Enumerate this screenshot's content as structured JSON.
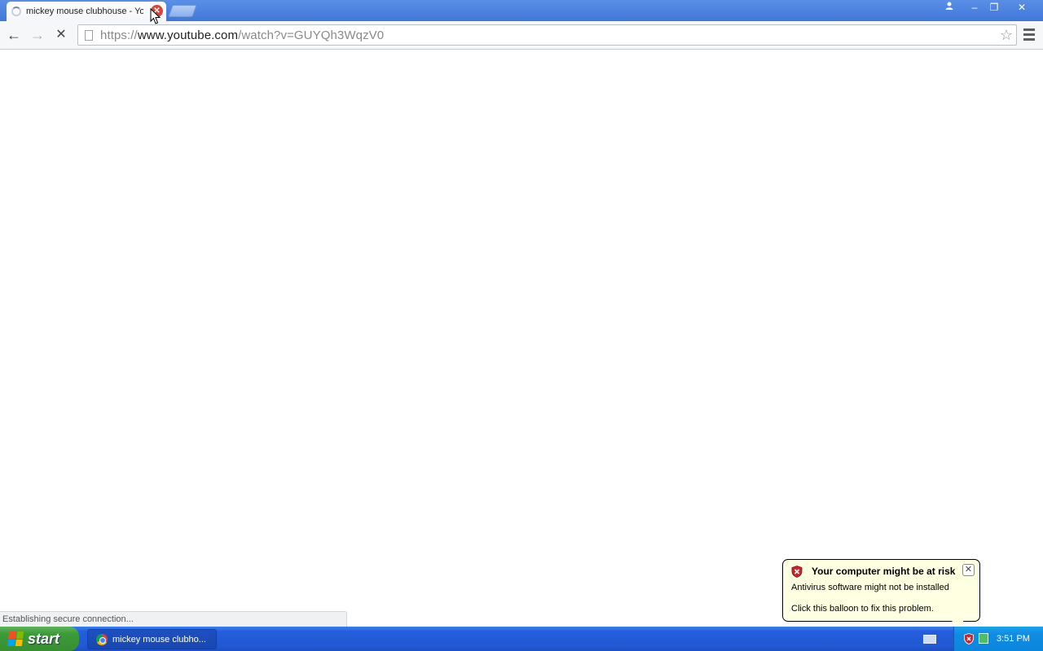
{
  "browser": {
    "tab_title": "mickey mouse clubhouse - Yo",
    "tab_close": "✕",
    "url_scheme": "https://",
    "url_host": "www.youtube.com",
    "url_path": "/watch?v=GUYQh3WqzV0",
    "back": "←",
    "forward": "→",
    "stop": "✕",
    "star": "☆",
    "window_buttons": {
      "user": "👤",
      "minimize": "–",
      "restore": "❐",
      "close": "✕"
    }
  },
  "status": {
    "text": "Establishing secure connection..."
  },
  "balloon": {
    "title": "Your computer might be at risk",
    "line1": "Antivirus software might not be installed",
    "line2": "Click this balloon to fix this problem.",
    "close": "✕"
  },
  "taskbar": {
    "start_label": "start",
    "task_label": "mickey mouse clubho...",
    "clock": "3:51 PM"
  },
  "colors": {
    "title_bar": "#4a82e0",
    "balloon_bg": "#ffffe1",
    "taskbar": "#245edb",
    "start": "#3c9b37",
    "tray": "#0f8ce3"
  }
}
